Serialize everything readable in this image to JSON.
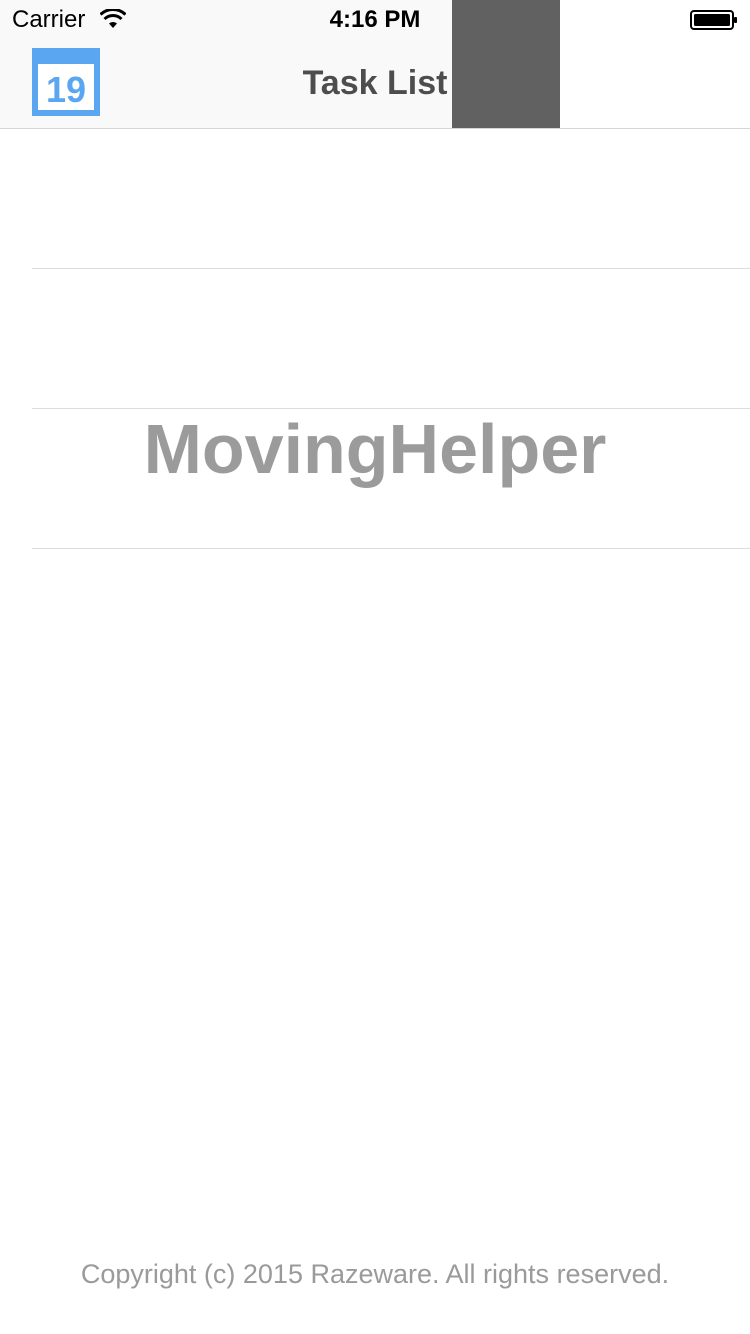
{
  "status_bar": {
    "carrier": "Carrier",
    "time": "4:16 PM",
    "wifi_icon": "wifi-icon",
    "battery_icon": "battery-icon"
  },
  "nav_bar": {
    "title": "Task List",
    "calendar_button_day": "19",
    "calendar_icon": "calendar-icon",
    "accent_color": "#5aa6f0"
  },
  "table": {
    "rows": [
      "",
      "",
      ""
    ]
  },
  "brand": {
    "name": "MovingHelper"
  },
  "footer": {
    "copyright": "Copyright (c) 2015 Razeware. All rights reserved."
  }
}
